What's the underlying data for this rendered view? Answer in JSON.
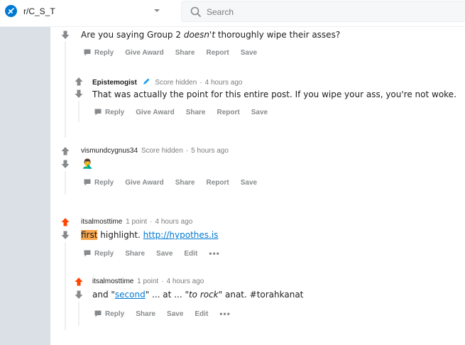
{
  "header": {
    "community": "r/C_S_T",
    "search_placeholder": "Search"
  },
  "comments": [
    {
      "id": "c1",
      "text_parts": [
        "Are you saying Group 2 ",
        "doesn't",
        " thoroughly wipe their asses?"
      ],
      "actions": [
        "Reply",
        "Give Award",
        "Share",
        "Report",
        "Save"
      ]
    },
    {
      "id": "c2",
      "author": "Epistemogist",
      "score": "Score hidden",
      "time": "4 hours ago",
      "text": "That was actually the point for this entire post. If you wipe your ass, you're not woke.",
      "actions": [
        "Reply",
        "Give Award",
        "Share",
        "Report",
        "Save"
      ]
    },
    {
      "id": "c3",
      "author": "vismundcygnus34",
      "score": "Score hidden",
      "time": "5 hours ago",
      "text": "🤦‍♂️",
      "actions": [
        "Reply",
        "Give Award",
        "Share",
        "Report",
        "Save"
      ]
    },
    {
      "id": "c4",
      "author": "itsalmosttime",
      "score": "1 point",
      "time": "4 hours ago",
      "highlight": "first",
      "text_mid": " highlight. ",
      "link": "http://hypothes.is",
      "actions": [
        "Reply",
        "Share",
        "Save",
        "Edit"
      ],
      "more": "•••"
    },
    {
      "id": "c5",
      "author": "itsalmosttime",
      "score": "1 point",
      "time": "4 hours ago",
      "text_a": "and \"",
      "link": "second",
      "text_b": "\" ... at ... \"",
      "italic": "to rock",
      "text_c": "\" anat. #torahkanat",
      "actions": [
        "Reply",
        "Share",
        "Save",
        "Edit"
      ],
      "more": "•••"
    }
  ],
  "meta_sep": "·",
  "colors": {
    "upvoted": "#ff4500",
    "neutral_vote": "#878a8c",
    "link": "#0079d3",
    "highlight": "#f7a64c",
    "gutter": "#dae0e6"
  }
}
